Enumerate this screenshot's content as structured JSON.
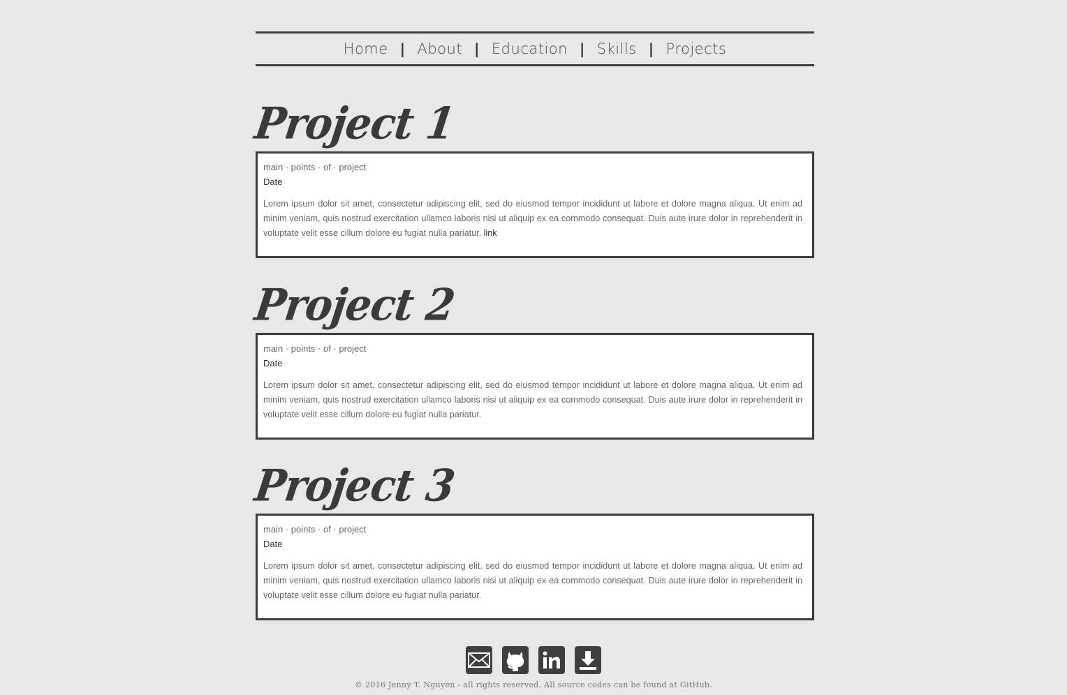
{
  "nav": {
    "items": [
      {
        "label": "Home"
      },
      {
        "label": "About"
      },
      {
        "label": "Education"
      },
      {
        "label": "Skills"
      },
      {
        "label": "Projects"
      }
    ],
    "separator": "|"
  },
  "projects": [
    {
      "title": "Project 1",
      "points": "main · points · of · project",
      "date": "Date",
      "description": "Lorem ipsum dolor sit amet, consectetur adipiscing elit, sed do eiusmod tempor incididunt ut labore et dolore magna aliqua. Ut enim ad minim veniam, quis nostrud exercitation ullamco laboris nisi ut aliquip ex ea commodo consequat. Duis aute irure dolor in reprehenderit in voluptate velit esse cillum dolore eu fugiat nulla pariatur.",
      "link_label": "link"
    },
    {
      "title": "Project 2",
      "points": "main · points · of · project",
      "date": "Date",
      "description": "Lorem ipsum dolor sit amet, consectetur adipiscing elit, sed do eiusmod tempor incididunt ut labore et dolore magna aliqua. Ut enim ad minim veniam, quis nostrud exercitation ullamco laboris nisi ut aliquip ex ea commodo consequat. Duis aute irure dolor in reprehenderit in voluptate velit esse cillum dolore eu fugiat nulla pariatur."
    },
    {
      "title": "Project 3",
      "points": "main · points · of · project",
      "date": "Date",
      "description": "Lorem ipsum dolor sit amet, consectetur adipiscing elit, sed do eiusmod tempor incididunt ut labore et dolore magna aliqua. Ut enim ad minim veniam, quis nostrud exercitation ullamco laboris nisi ut aliquip ex ea commodo consequat. Duis aute irure dolor in reprehenderit in voluptate velit esse cillum dolore eu fugiat nulla pariatur."
    }
  ],
  "footer": {
    "icons": [
      "mail-icon",
      "github-icon",
      "linkedin-icon",
      "download-icon"
    ],
    "copyright": "© 2016 Jenny T. Nguyen - all rights reserved. All source codes can be found at GitHub."
  },
  "colors": {
    "background": "#e8e8e8",
    "border": "#3c3c3c",
    "card": "#ffffff"
  }
}
